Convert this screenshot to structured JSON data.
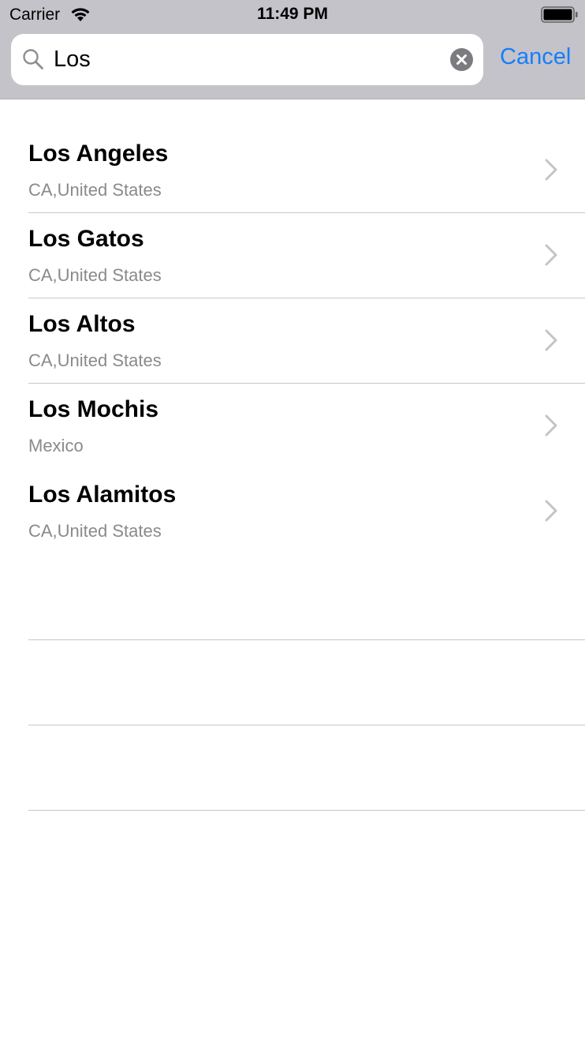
{
  "status_bar": {
    "carrier": "Carrier",
    "time": "11:49 PM"
  },
  "search": {
    "value": "Los",
    "cancel_label": "Cancel"
  },
  "results": [
    {
      "city": "Los Angeles",
      "region": "CA,United States"
    },
    {
      "city": "Los Gatos",
      "region": "CA,United States"
    },
    {
      "city": "Los Altos",
      "region": "CA,United States"
    },
    {
      "city": "Los Mochis",
      "region": "Mexico"
    },
    {
      "city": "Los Alamitos",
      "region": "CA,United States"
    }
  ],
  "colors": {
    "header_bg": "#c3c3c9",
    "accent": "#157efb",
    "secondary_text": "#8a8a8e",
    "separator": "#c8c7cc"
  }
}
